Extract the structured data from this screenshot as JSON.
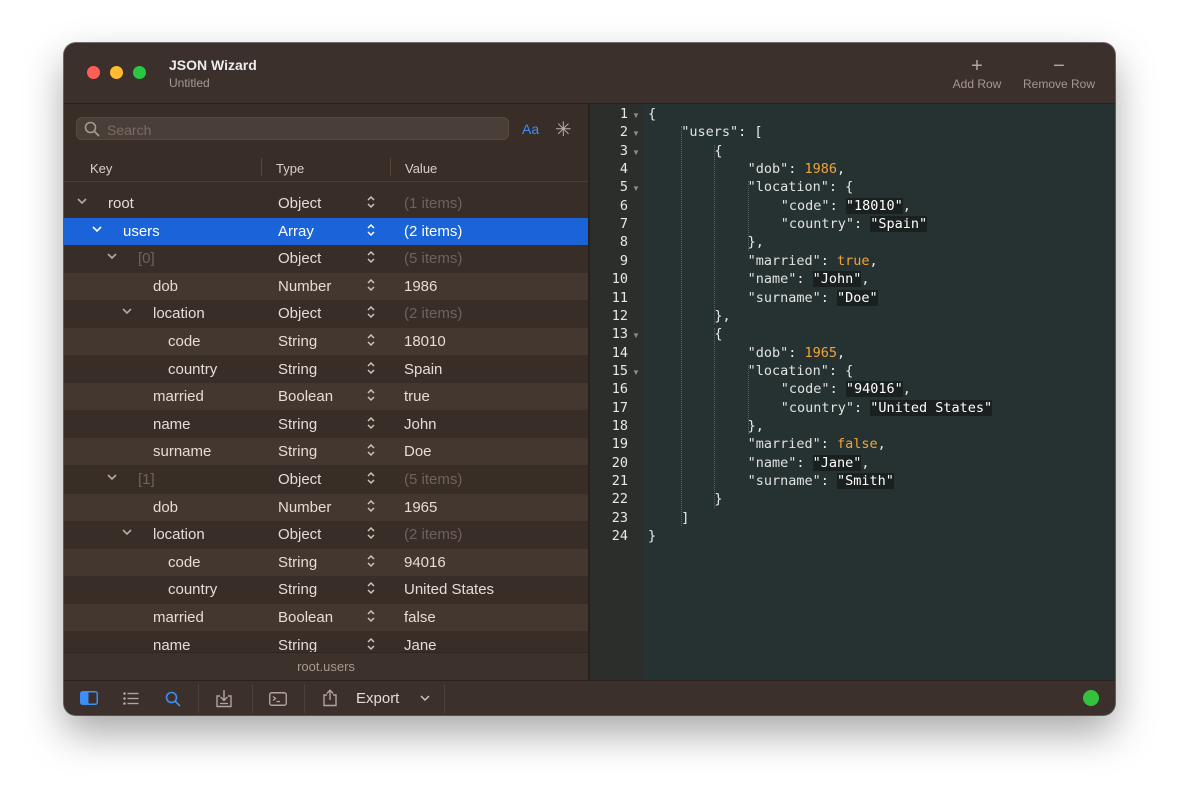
{
  "window": {
    "title": "JSON Wizard",
    "subtitle": "Untitled"
  },
  "toolbar": {
    "add_row": "Add Row",
    "remove_row": "Remove Row"
  },
  "search": {
    "placeholder": "Search",
    "case_toggle": "Aa",
    "regex_toggle": "✳"
  },
  "table": {
    "columns": [
      "Key",
      "Type",
      "Value"
    ],
    "rows": [
      {
        "key": "root",
        "type": "Object",
        "value": "(1 items)",
        "depth": 0,
        "expanded": true,
        "key_dim": false,
        "value_dim": true,
        "selected": false
      },
      {
        "key": "users",
        "type": "Array",
        "value": "(2 items)",
        "depth": 1,
        "expanded": true,
        "key_dim": false,
        "value_dim": false,
        "selected": true
      },
      {
        "key": "[0]",
        "type": "Object",
        "value": "(5 items)",
        "depth": 2,
        "expanded": true,
        "key_dim": true,
        "value_dim": true,
        "selected": false
      },
      {
        "key": "dob",
        "type": "Number",
        "value": "1986",
        "depth": 3,
        "expanded": null,
        "key_dim": false,
        "value_dim": false,
        "selected": false
      },
      {
        "key": "location",
        "type": "Object",
        "value": "(2 items)",
        "depth": 3,
        "expanded": true,
        "key_dim": false,
        "value_dim": true,
        "selected": false
      },
      {
        "key": "code",
        "type": "String",
        "value": "18010",
        "depth": 4,
        "expanded": null,
        "key_dim": false,
        "value_dim": false,
        "selected": false
      },
      {
        "key": "country",
        "type": "String",
        "value": "Spain",
        "depth": 4,
        "expanded": null,
        "key_dim": false,
        "value_dim": false,
        "selected": false
      },
      {
        "key": "married",
        "type": "Boolean",
        "value": "true",
        "depth": 3,
        "expanded": null,
        "key_dim": false,
        "value_dim": false,
        "selected": false
      },
      {
        "key": "name",
        "type": "String",
        "value": "John",
        "depth": 3,
        "expanded": null,
        "key_dim": false,
        "value_dim": false,
        "selected": false
      },
      {
        "key": "surname",
        "type": "String",
        "value": "Doe",
        "depth": 3,
        "expanded": null,
        "key_dim": false,
        "value_dim": false,
        "selected": false
      },
      {
        "key": "[1]",
        "type": "Object",
        "value": "(5 items)",
        "depth": 2,
        "expanded": true,
        "key_dim": true,
        "value_dim": true,
        "selected": false
      },
      {
        "key": "dob",
        "type": "Number",
        "value": "1965",
        "depth": 3,
        "expanded": null,
        "key_dim": false,
        "value_dim": false,
        "selected": false
      },
      {
        "key": "location",
        "type": "Object",
        "value": "(2 items)",
        "depth": 3,
        "expanded": true,
        "key_dim": false,
        "value_dim": true,
        "selected": false
      },
      {
        "key": "code",
        "type": "String",
        "value": "94016",
        "depth": 4,
        "expanded": null,
        "key_dim": false,
        "value_dim": false,
        "selected": false
      },
      {
        "key": "country",
        "type": "String",
        "value": "United States",
        "depth": 4,
        "expanded": null,
        "key_dim": false,
        "value_dim": false,
        "selected": false
      },
      {
        "key": "married",
        "type": "Boolean",
        "value": "false",
        "depth": 3,
        "expanded": null,
        "key_dim": false,
        "value_dim": false,
        "selected": false
      },
      {
        "key": "name",
        "type": "String",
        "value": "Jane",
        "depth": 3,
        "expanded": null,
        "key_dim": false,
        "value_dim": false,
        "selected": false
      }
    ]
  },
  "path_bar": {
    "path": "root.users"
  },
  "editor": {
    "lines": [
      {
        "n": "1",
        "fold": true,
        "indent": 0,
        "tokens": [
          {
            "t": "p",
            "v": "{"
          }
        ]
      },
      {
        "n": "2",
        "fold": true,
        "indent": 1,
        "tokens": [
          {
            "t": "k",
            "v": "\"users\""
          },
          {
            "t": "p",
            "v": ": ["
          }
        ]
      },
      {
        "n": "3",
        "fold": true,
        "indent": 2,
        "tokens": [
          {
            "t": "p",
            "v": "{"
          }
        ]
      },
      {
        "n": "4",
        "fold": false,
        "indent": 3,
        "tokens": [
          {
            "t": "k",
            "v": "\"dob\""
          },
          {
            "t": "p",
            "v": ": "
          },
          {
            "t": "n",
            "v": "1986"
          },
          {
            "t": "p",
            "v": ","
          }
        ]
      },
      {
        "n": "5",
        "fold": true,
        "indent": 3,
        "tokens": [
          {
            "t": "k",
            "v": "\"location\""
          },
          {
            "t": "p",
            "v": ": {"
          }
        ]
      },
      {
        "n": "6",
        "fold": false,
        "indent": 4,
        "tokens": [
          {
            "t": "k",
            "v": "\"code\""
          },
          {
            "t": "p",
            "v": ": "
          },
          {
            "t": "s",
            "v": "\"18010\""
          },
          {
            "t": "p",
            "v": ","
          }
        ]
      },
      {
        "n": "7",
        "fold": false,
        "indent": 4,
        "tokens": [
          {
            "t": "k",
            "v": "\"country\""
          },
          {
            "t": "p",
            "v": ": "
          },
          {
            "t": "s",
            "v": "\"Spain\""
          }
        ]
      },
      {
        "n": "8",
        "fold": false,
        "indent": 3,
        "tokens": [
          {
            "t": "p",
            "v": "},"
          }
        ]
      },
      {
        "n": "9",
        "fold": false,
        "indent": 3,
        "tokens": [
          {
            "t": "k",
            "v": "\"married\""
          },
          {
            "t": "p",
            "v": ": "
          },
          {
            "t": "n",
            "v": "true"
          },
          {
            "t": "p",
            "v": ","
          }
        ]
      },
      {
        "n": "10",
        "fold": false,
        "indent": 3,
        "tokens": [
          {
            "t": "k",
            "v": "\"name\""
          },
          {
            "t": "p",
            "v": ": "
          },
          {
            "t": "s",
            "v": "\"John\""
          },
          {
            "t": "p",
            "v": ","
          }
        ]
      },
      {
        "n": "11",
        "fold": false,
        "indent": 3,
        "tokens": [
          {
            "t": "k",
            "v": "\"surname\""
          },
          {
            "t": "p",
            "v": ": "
          },
          {
            "t": "s",
            "v": "\"Doe\""
          }
        ]
      },
      {
        "n": "12",
        "fold": false,
        "indent": 2,
        "tokens": [
          {
            "t": "p",
            "v": "},"
          }
        ]
      },
      {
        "n": "13",
        "fold": true,
        "indent": 2,
        "tokens": [
          {
            "t": "p",
            "v": "{"
          }
        ]
      },
      {
        "n": "14",
        "fold": false,
        "indent": 3,
        "tokens": [
          {
            "t": "k",
            "v": "\"dob\""
          },
          {
            "t": "p",
            "v": ": "
          },
          {
            "t": "n",
            "v": "1965"
          },
          {
            "t": "p",
            "v": ","
          }
        ]
      },
      {
        "n": "15",
        "fold": true,
        "indent": 3,
        "tokens": [
          {
            "t": "k",
            "v": "\"location\""
          },
          {
            "t": "p",
            "v": ": {"
          }
        ]
      },
      {
        "n": "16",
        "fold": false,
        "indent": 4,
        "tokens": [
          {
            "t": "k",
            "v": "\"code\""
          },
          {
            "t": "p",
            "v": ": "
          },
          {
            "t": "s",
            "v": "\"94016\""
          },
          {
            "t": "p",
            "v": ","
          }
        ]
      },
      {
        "n": "17",
        "fold": false,
        "indent": 4,
        "tokens": [
          {
            "t": "k",
            "v": "\"country\""
          },
          {
            "t": "p",
            "v": ": "
          },
          {
            "t": "s",
            "v": "\"United States\""
          }
        ]
      },
      {
        "n": "18",
        "fold": false,
        "indent": 3,
        "tokens": [
          {
            "t": "p",
            "v": "},"
          }
        ]
      },
      {
        "n": "19",
        "fold": false,
        "indent": 3,
        "tokens": [
          {
            "t": "k",
            "v": "\"married\""
          },
          {
            "t": "p",
            "v": ": "
          },
          {
            "t": "n",
            "v": "false"
          },
          {
            "t": "p",
            "v": ","
          }
        ]
      },
      {
        "n": "20",
        "fold": false,
        "indent": 3,
        "tokens": [
          {
            "t": "k",
            "v": "\"name\""
          },
          {
            "t": "p",
            "v": ": "
          },
          {
            "t": "s",
            "v": "\"Jane\""
          },
          {
            "t": "p",
            "v": ","
          }
        ]
      },
      {
        "n": "21",
        "fold": false,
        "indent": 3,
        "tokens": [
          {
            "t": "k",
            "v": "\"surname\""
          },
          {
            "t": "p",
            "v": ": "
          },
          {
            "t": "s",
            "v": "\"Smith\""
          }
        ]
      },
      {
        "n": "22",
        "fold": false,
        "indent": 2,
        "tokens": [
          {
            "t": "p",
            "v": "}"
          }
        ]
      },
      {
        "n": "23",
        "fold": false,
        "indent": 1,
        "tokens": [
          {
            "t": "p",
            "v": "]"
          }
        ]
      },
      {
        "n": "24",
        "fold": false,
        "indent": 0,
        "tokens": [
          {
            "t": "p",
            "v": "}"
          }
        ]
      }
    ]
  },
  "bottom_bar": {
    "export_label": "Export",
    "icons": [
      "sidebar-icon",
      "list-icon",
      "search-icon",
      "import-icon",
      "terminal-icon",
      "share-icon"
    ],
    "status": "connected"
  },
  "colors": {
    "selection": "#1a63d8",
    "accent": "#3d8ef6",
    "number": "#f0a53a",
    "status_ok": "#34c23c"
  }
}
